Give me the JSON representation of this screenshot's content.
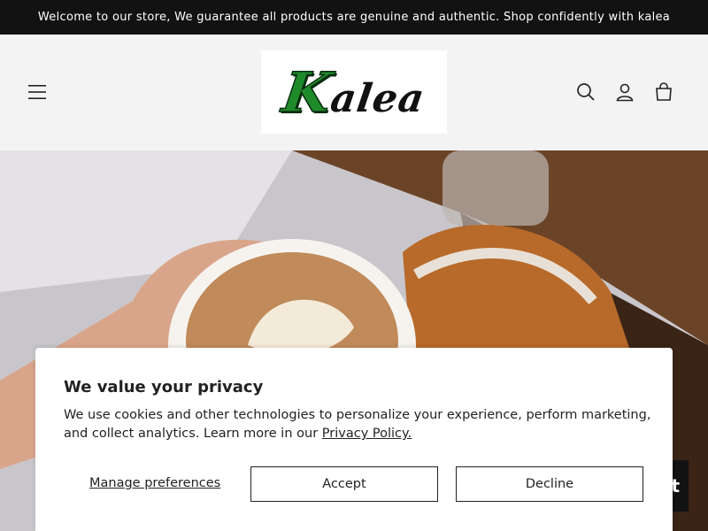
{
  "announcement": {
    "text": "Welcome to our store, We guarantee all products are genuine and authentic. Shop confidently with kalea"
  },
  "header": {
    "logo_k": "K",
    "logo_rest": "alea",
    "icons": {
      "menu": "menu-icon",
      "search": "search-icon",
      "account": "account-icon",
      "cart": "cart-icon"
    }
  },
  "chat": {
    "label": "t"
  },
  "cookie_banner": {
    "title": "We value your privacy",
    "body": "We use cookies and other technologies to personalize your experience, perform marketing, and collect analytics. Learn more in our ",
    "privacy_link": "Privacy Policy.",
    "manage_label": "Manage preferences",
    "accept_label": "Accept",
    "decline_label": "Decline"
  }
}
